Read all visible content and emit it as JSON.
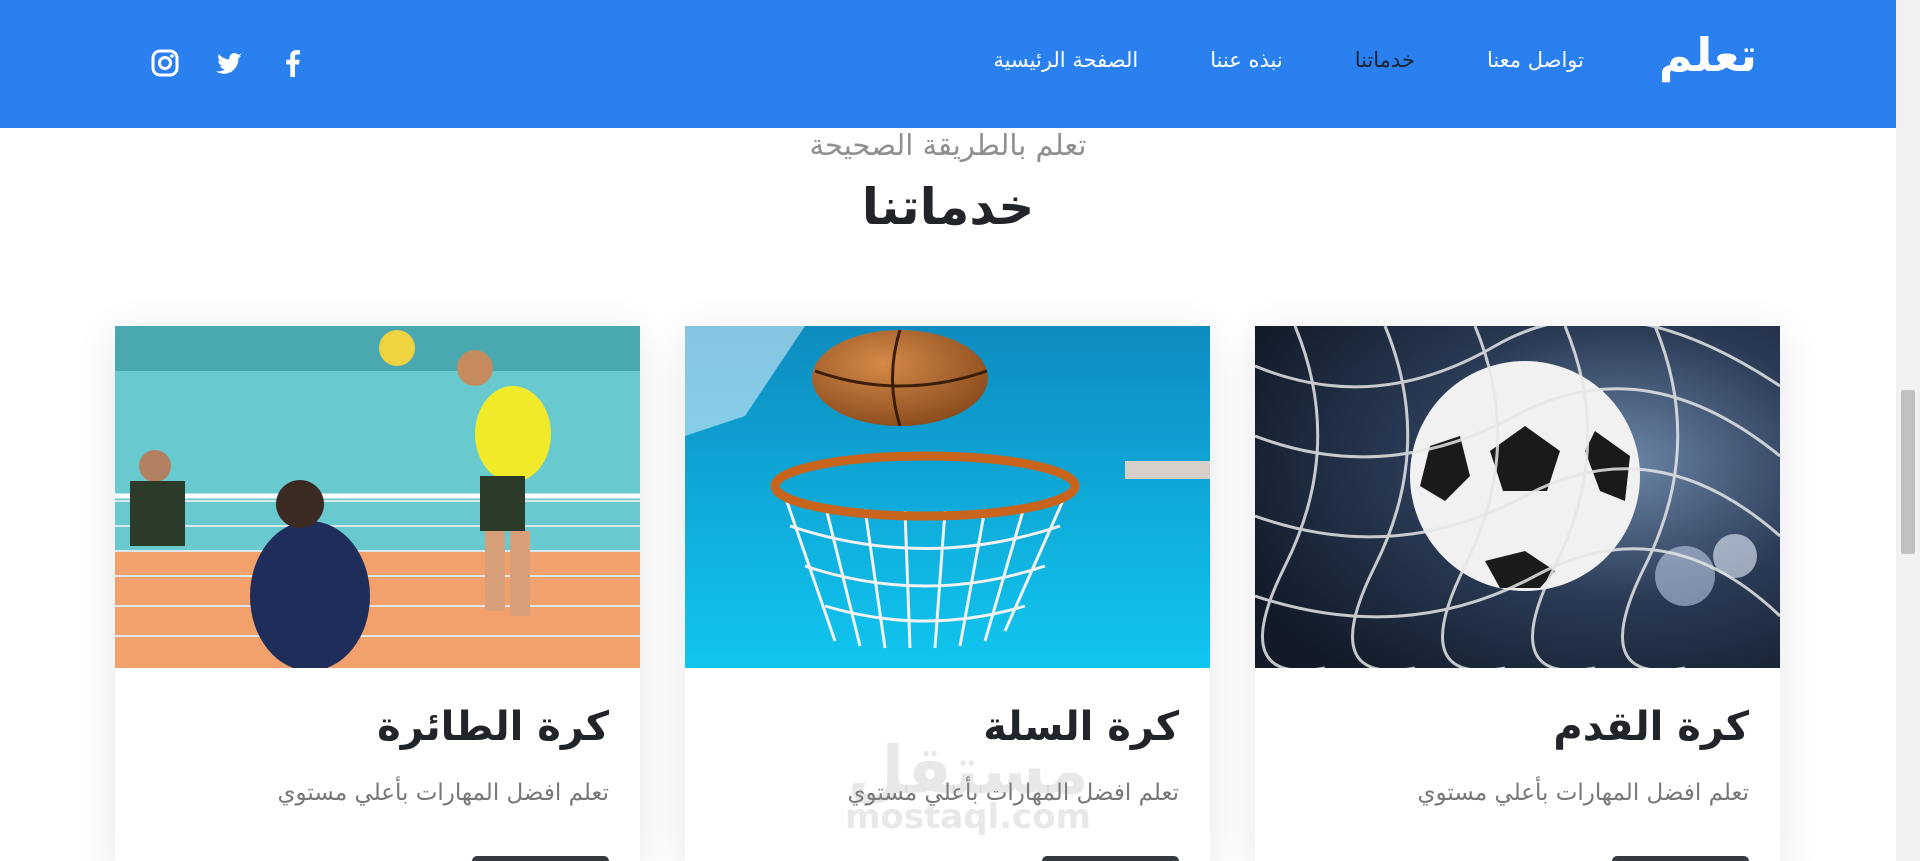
{
  "navbar": {
    "brand": "تعلم",
    "links": [
      {
        "label": "الصفحة الرئيسية",
        "active": false
      },
      {
        "label": "نبذه عننا",
        "active": false
      },
      {
        "label": "خدماتنا",
        "active": true
      },
      {
        "label": "تواصل معنا",
        "active": false
      }
    ],
    "social_icons": [
      "facebook-icon",
      "twitter-icon",
      "instagram-icon"
    ],
    "background_color": "#2b80f0"
  },
  "section": {
    "subtitle": "تعلم بالطريقة الصحيحة",
    "title": "خدماتنا"
  },
  "cards": [
    {
      "title": "كرة القدم",
      "text": "تعلم افضل المهارات بأعلي مستوي",
      "image": "soccer-ball-in-net"
    },
    {
      "title": "كرة السلة",
      "text": "تعلم افضل المهارات بأعلي مستوي",
      "image": "basketball-hoop"
    },
    {
      "title": "كرة الطائرة",
      "text": "تعلم افضل المهارات بأعلي مستوي",
      "image": "volleyball-spike"
    }
  ],
  "watermark": {
    "arabic": "مستقل",
    "latin": "mostaql.com"
  }
}
